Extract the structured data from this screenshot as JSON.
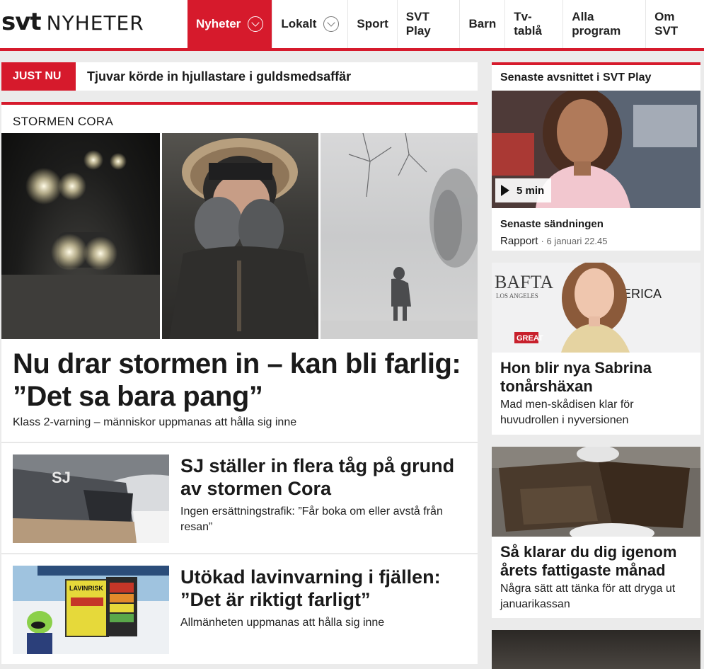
{
  "header": {
    "logo_brand": "svt",
    "logo_section": "NYHETER",
    "nav": [
      {
        "label": "Nyheter"
      },
      {
        "label": "Lokalt"
      },
      {
        "label": "Sport"
      },
      {
        "label": "SVT Play"
      },
      {
        "label": "Barn"
      },
      {
        "label": "Tv-tablå"
      },
      {
        "label": "Alla program"
      },
      {
        "label": "Om SVT"
      }
    ],
    "accent_color": "#d61a2c"
  },
  "just_nu": {
    "badge": "JUST NU",
    "text": "Tjuvar körde in hjullastare i guldsmedsaffär"
  },
  "main_story": {
    "label": "STORMEN CORA",
    "headline": "Nu drar stormen in – kan bli farlig: ”Det sa bara pang”",
    "lede": "Klass 2-varning – människor uppmanas att hålla sig inne"
  },
  "list": [
    {
      "headline": "SJ ställer in flera tåg på grund av stormen Cora",
      "lede": "Ingen ersättningstrafik: ”Får boka om eller avstå från resan”"
    },
    {
      "headline": "Utökad lavinvarning i fjällen: ”Det är riktigt farligt”",
      "lede": "Allmänheten uppmanas att hålla sig inne"
    }
  ],
  "side": {
    "play": {
      "title": "Senaste avsnittet i SVT Play",
      "duration": "5 min",
      "subtitle": "Senaste sändningen",
      "program": "Rapport",
      "date": "· 6 januari 22.45"
    },
    "card1": {
      "headline": "Hon blir nya Sabrina tonårshäxan",
      "lede": "Mad men-skådisen klar för huvudrollen i nyversionen",
      "img_text": {
        "bafta": "BAFTA",
        "los_angeles": "LOS ANGELES",
        "america": "MERICA",
        "great": "GREAT"
      }
    },
    "card2": {
      "headline": "Så klarar du dig igenom årets fattigaste månad",
      "lede": "Några sätt att tänka för att dryga ut januarikassan"
    }
  },
  "image_text": {
    "sj_logo": "SJ",
    "lavinrisk": "LAVINRISK"
  }
}
